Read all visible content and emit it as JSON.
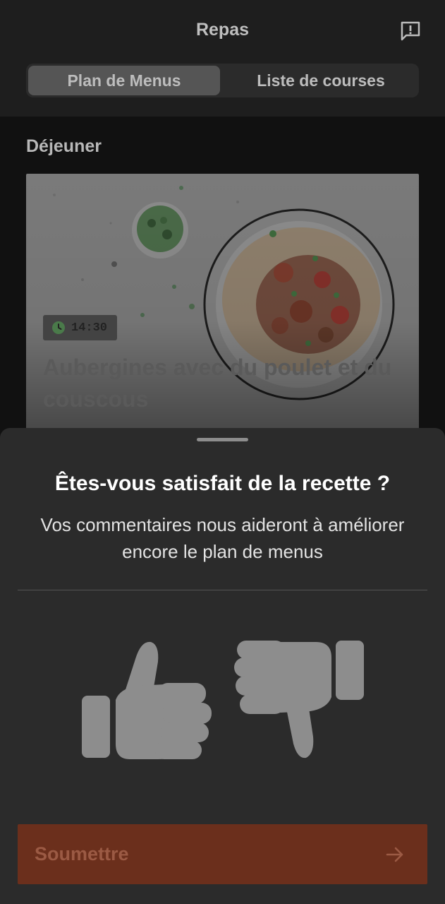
{
  "header": {
    "title": "Repas",
    "feedback_icon": "feedback-icon",
    "tabs": [
      {
        "label": "Plan de Menus",
        "active": true
      },
      {
        "label": "Liste de courses",
        "active": false
      }
    ]
  },
  "content": {
    "section_title": "Déjeuner",
    "recipe": {
      "time": "14:30",
      "title": "Aubergines avec du poulet et du couscous",
      "time_icon": "clock-icon"
    }
  },
  "sheet": {
    "title": "Êtes-vous satisfait de la recette ?",
    "subtitle": "Vos commentaires nous aideront à améliorer encore le plan de menus",
    "thumbs_up_icon": "thumbs-up-icon",
    "thumbs_down_icon": "thumbs-down-icon",
    "submit_label": "Soumettre",
    "submit_icon": "arrow-right-icon"
  },
  "colors": {
    "accent": "#6b2f1c",
    "accent_text": "#9b5a44",
    "sheet_bg": "#2b2b2b",
    "icon_grey": "#8d8d8d"
  }
}
